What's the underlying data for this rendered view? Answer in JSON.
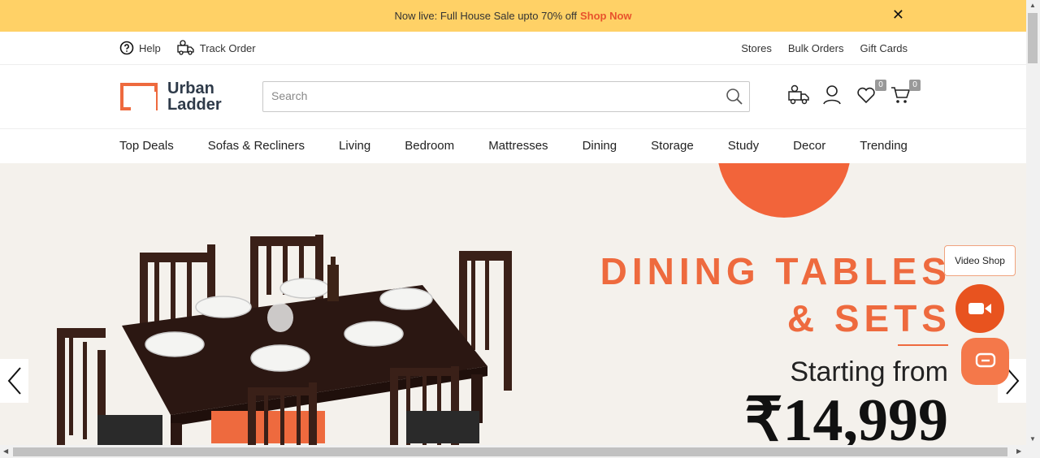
{
  "announcement": {
    "text": "Now live: Full House Sale upto 70% off",
    "link": "Shop Now",
    "close": "✕"
  },
  "utility": {
    "help": "Help",
    "track_order": "Track Order",
    "stores": "Stores",
    "bulk_orders": "Bulk Orders",
    "gift_cards": "Gift Cards"
  },
  "brand": {
    "line1": "Urban",
    "line2": "Ladder",
    "accent": "#ee6a3e"
  },
  "search": {
    "placeholder": "Search",
    "value": ""
  },
  "header_icons": {
    "wishlist_count": "0",
    "cart_count": "0"
  },
  "nav": [
    "Top Deals",
    "Sofas & Recliners",
    "Living",
    "Bedroom",
    "Mattresses",
    "Dining",
    "Storage",
    "Study",
    "Decor",
    "Trending"
  ],
  "hero": {
    "title_line1": "DINING TABLES",
    "title_line2": "& SETS",
    "subtitle": "Starting from",
    "price": "₹14,999",
    "accent": "#ee6a3e"
  },
  "widgets": {
    "video_shop": "Video Shop"
  }
}
